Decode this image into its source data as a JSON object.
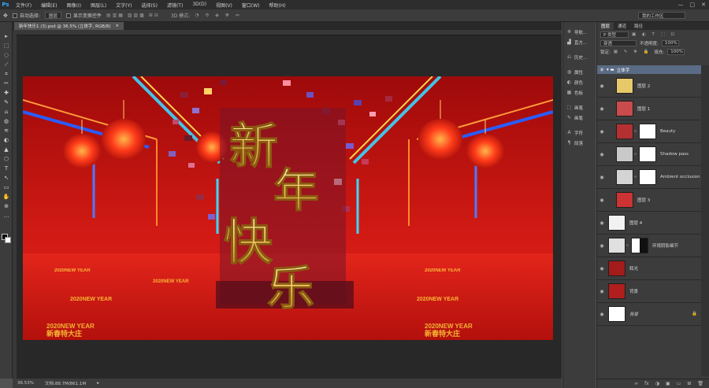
{
  "app": {
    "logo": "Ps"
  },
  "menu": [
    "文件(F)",
    "编辑(E)",
    "图像(I)",
    "图层(L)",
    "文字(Y)",
    "选择(S)",
    "滤镜(T)",
    "3D(D)",
    "视图(V)",
    "窗口(W)",
    "帮助(H)"
  ],
  "window_controls": [
    "—",
    "□",
    "✕"
  ],
  "options_bar": {
    "auto_select_label": "自动选择:",
    "auto_select_value": "图层",
    "show_transform_label": "显示变换控件",
    "mode_3d_label": "3D 模式:",
    "workspace_value": "我的工作区"
  },
  "document": {
    "tab_title": "新年快乐1 (3).psd @ 36.5% (立体字, RGB/8)",
    "zoom": "36.53%",
    "doc_size": "文档:88.7M/861.1M"
  },
  "canvas_text": {
    "chars": [
      "新",
      "年",
      "快",
      "乐"
    ],
    "floor_caption_1": "2020NEW YEAR",
    "floor_caption_2": "新春特大庄"
  },
  "mid_dock": {
    "items": [
      {
        "icon": "navigator-icon",
        "glyph": "✲",
        "label": "导航..."
      },
      {
        "icon": "histogram-icon",
        "glyph": "▟",
        "label": "直方..."
      },
      {
        "icon": "history-icon",
        "glyph": "⎌",
        "label": "历史..."
      },
      {
        "icon": "brush-preset-icon",
        "glyph": "◍",
        "label": "属性"
      },
      {
        "icon": "color-icon",
        "glyph": "◐",
        "label": "颜色"
      },
      {
        "icon": "swatches-icon",
        "glyph": "▦",
        "label": "色板"
      },
      {
        "icon": "adjust-icon",
        "glyph": "⬚",
        "label": "画笔"
      },
      {
        "icon": "brush-icon",
        "glyph": "✎",
        "label": "画笔"
      },
      {
        "icon": "char-icon",
        "glyph": "A",
        "label": "字符"
      },
      {
        "icon": "para-icon",
        "glyph": "¶",
        "label": "段落"
      }
    ]
  },
  "layers_panel": {
    "tabs": [
      "图层",
      "通道",
      "路径"
    ],
    "filter_value": "P 类型",
    "blend_mode": "穿透",
    "opacity_label": "不透明度:",
    "opacity_value": "100%",
    "lock_label": "锁定:",
    "fill_label": "填充:",
    "fill_value": "100%",
    "group_name": "立体字",
    "layers": [
      {
        "name": "图层 2",
        "thumb": "#e8c96a"
      },
      {
        "name": "图层 1",
        "thumb": "#c94b4b"
      },
      {
        "name": "Beauty",
        "thumb": "#b43030"
      },
      {
        "name": "Shadow pass",
        "thumb": "#c9c9c9"
      },
      {
        "name": "Ambient occlusion",
        "thumb": "#d4d4d4"
      },
      {
        "name": "图层 3",
        "thumb": "#cc3333"
      },
      {
        "name": "图层 4",
        "thumb": "#f2f2f2"
      },
      {
        "name": "环境阴影细节",
        "thumb": "#e0e0e0"
      },
      {
        "name": "辉光",
        "thumb": "#a31b1b"
      },
      {
        "name": "背景",
        "thumb": "#b01e1e"
      },
      {
        "name": "背景",
        "thumb": "#ffffff"
      }
    ],
    "bottom_icons": [
      "∞",
      "fx",
      "◑",
      "▣",
      "▭",
      "⊞",
      "🗑"
    ]
  },
  "tools": [
    "▸",
    "⬚",
    "◌",
    "⟋",
    "⌗",
    "✂",
    "✚",
    "✎",
    "⌂",
    "◍",
    "≋",
    "◐",
    "▲",
    "⬡",
    "T",
    "↖",
    "▭",
    "✋",
    "⊕",
    "…"
  ]
}
